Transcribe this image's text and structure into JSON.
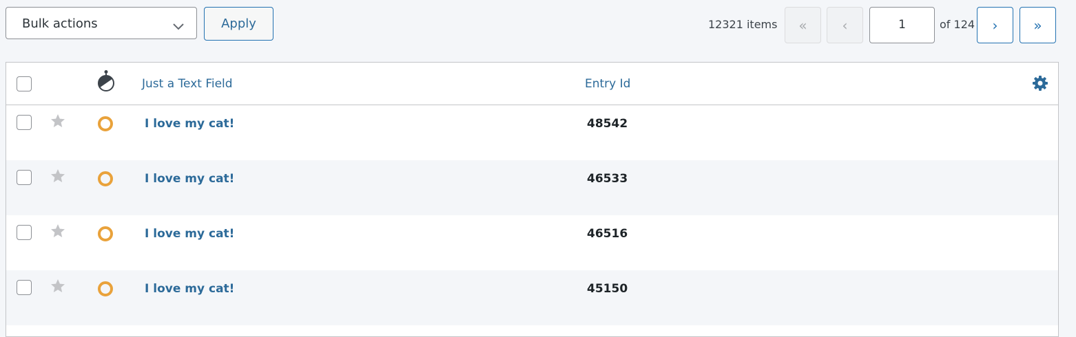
{
  "bulk": {
    "selected": "Bulk actions",
    "apply_label": "Apply"
  },
  "pagination": {
    "items_count": "12321 items",
    "first": "«",
    "prev": "‹",
    "current_page": "1",
    "of_pages": "of 124",
    "next": "›",
    "last": "»"
  },
  "table": {
    "columns": {
      "text_field": "Just a Text Field",
      "entry_id": "Entry Id"
    },
    "rows": [
      {
        "text": "I love my cat!",
        "entry_id": "48542"
      },
      {
        "text": "I love my cat!",
        "entry_id": "46533"
      },
      {
        "text": "I love my cat!",
        "entry_id": "46516"
      },
      {
        "text": "I love my cat!",
        "entry_id": "45150"
      }
    ]
  },
  "colors": {
    "accent": "#2271b1",
    "link": "#2c6a99",
    "status_pending": "#e9a23b",
    "star_inactive": "#c3c4c7"
  },
  "icons": {
    "read_status_header": "read-status-icon",
    "settings": "gear-icon",
    "row_star": "star-icon",
    "row_status": "status-circle-icon",
    "dropdown": "chevron-down-icon"
  }
}
